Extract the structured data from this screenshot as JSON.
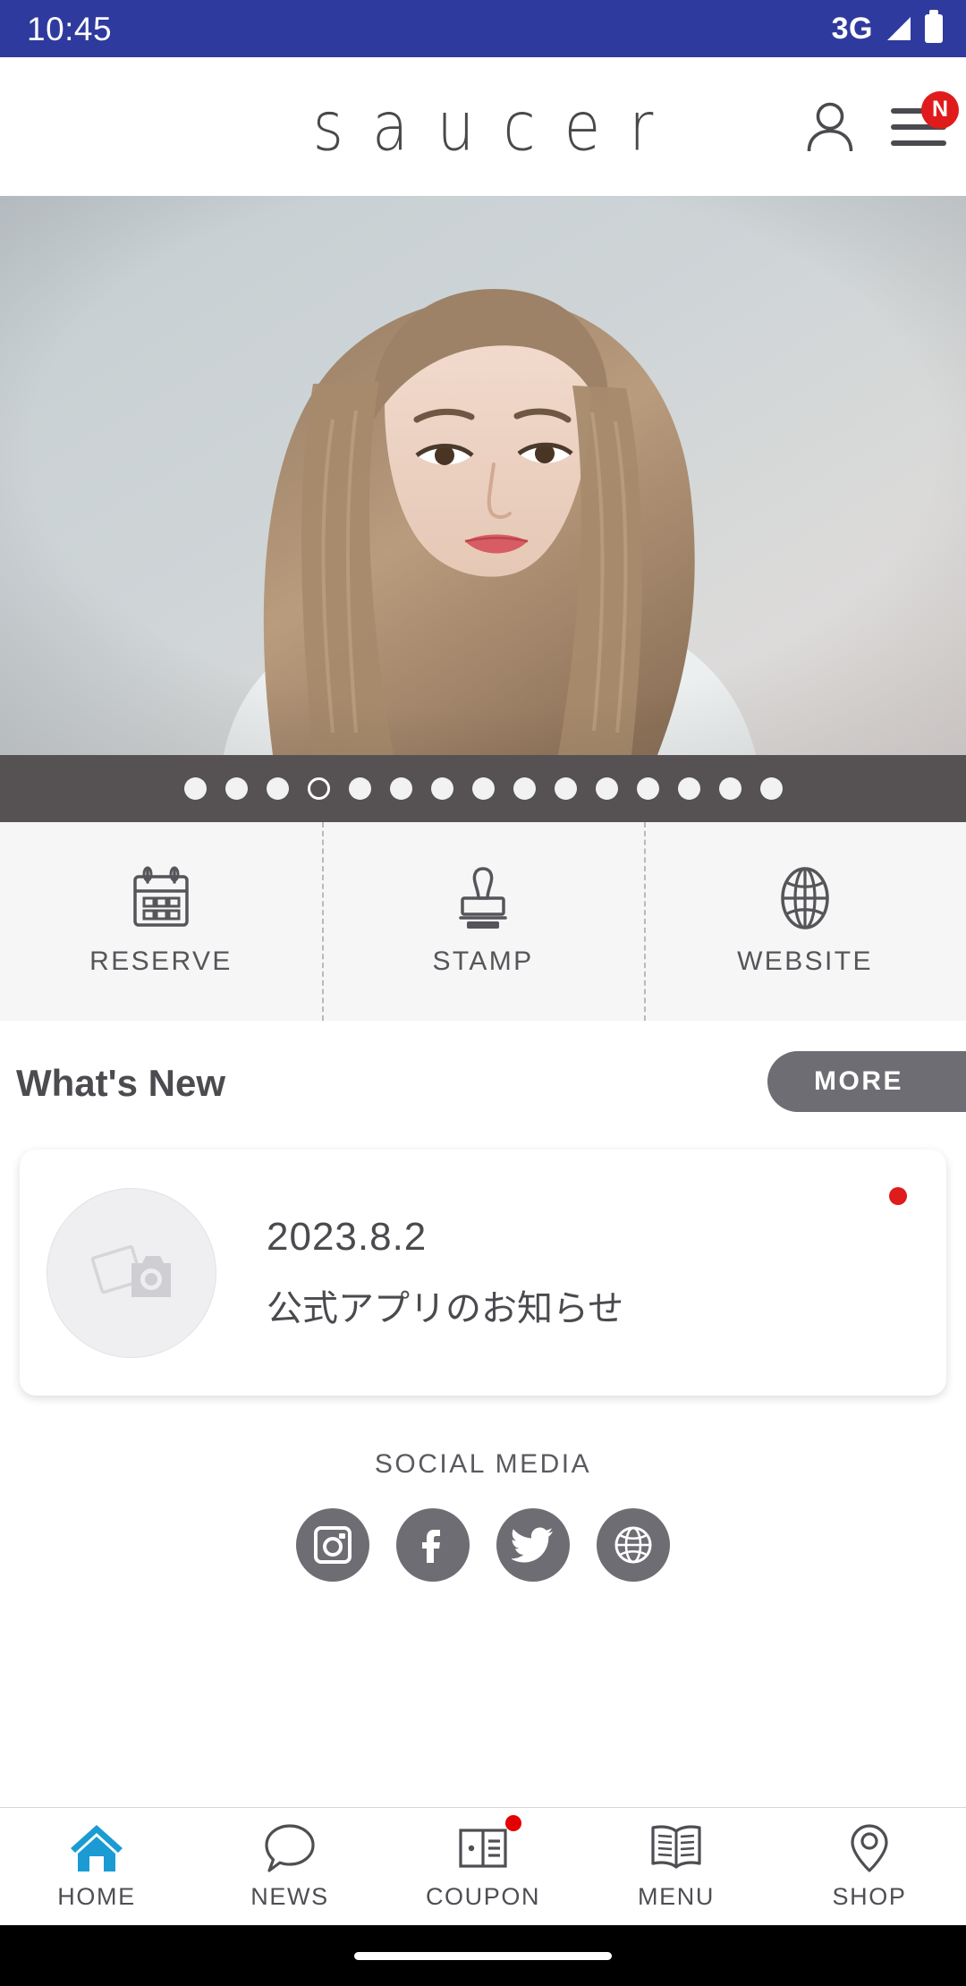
{
  "status_bar": {
    "time": "10:45",
    "network": "3G",
    "signal_icon": "signal-icon",
    "battery_icon": "battery-icon"
  },
  "header": {
    "logo_text": "saucer",
    "account_icon": "person-icon",
    "menu_icon": "hamburger-menu-icon",
    "menu_badge": "N"
  },
  "hero": {
    "alt": "salon hairstyle model photo",
    "carousel": {
      "total_slides": 15,
      "active_index": 4
    }
  },
  "quick_actions": [
    {
      "label": "RESERVE",
      "icon": "calendar-icon"
    },
    {
      "label": "STAMP",
      "icon": "stamp-icon"
    },
    {
      "label": "WEBSITE",
      "icon": "globe-icon"
    }
  ],
  "whats_new": {
    "title": "What's New",
    "more_label": "MORE",
    "items": [
      {
        "date": "2023.8.2",
        "subject": "公式アプリのお知らせ",
        "thumb_icon": "photo-camera-placeholder-icon",
        "unread": true
      }
    ]
  },
  "social_media": {
    "title": "SOCIAL MEDIA",
    "links": [
      {
        "name": "instagram",
        "icon": "instagram-icon"
      },
      {
        "name": "facebook",
        "icon": "facebook-icon"
      },
      {
        "name": "twitter",
        "icon": "twitter-icon"
      },
      {
        "name": "website",
        "icon": "globe-icon"
      }
    ]
  },
  "bottom_nav": {
    "active_index": 0,
    "active_color": "#1b9bd3",
    "items": [
      {
        "label": "HOME",
        "icon": "home-icon",
        "badge": false
      },
      {
        "label": "NEWS",
        "icon": "speech-bubble-icon",
        "badge": false
      },
      {
        "label": "COUPON",
        "icon": "ticket-icon",
        "badge": true
      },
      {
        "label": "MENU",
        "icon": "open-book-icon",
        "badge": false
      },
      {
        "label": "SHOP",
        "icon": "location-pin-icon",
        "badge": false
      }
    ]
  },
  "colors": {
    "status_bar": "#2f3a9e",
    "dots_bar": "#565254",
    "more_button": "#6e6d73",
    "badge_red": "#e01b1b",
    "home_blue": "#1b9bd3",
    "action_bg": "#f6f6f7"
  }
}
